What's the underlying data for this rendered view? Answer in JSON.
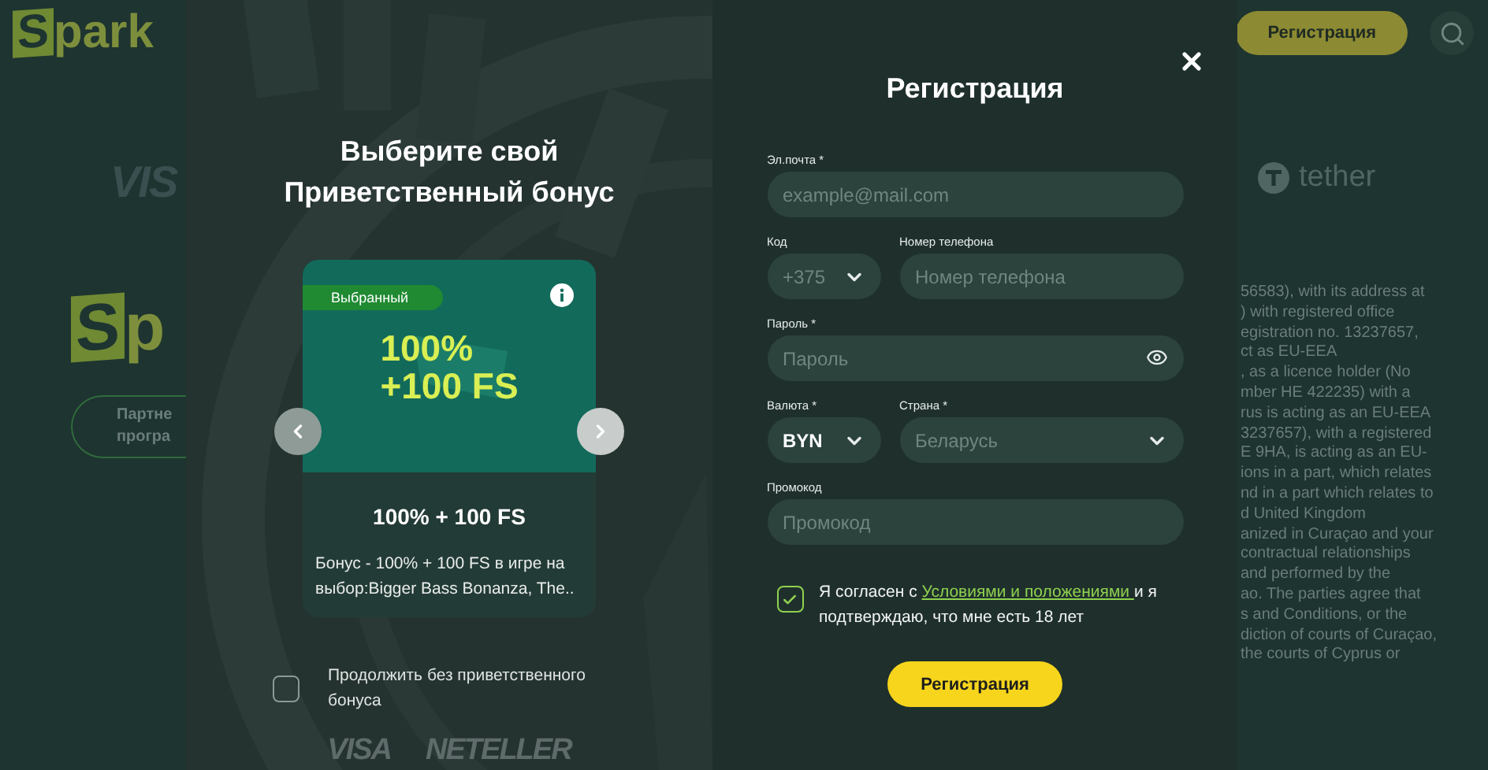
{
  "background_page": {
    "logo": {
      "mark": "S",
      "rest": "park"
    },
    "header_button": "Регистрация",
    "payment_logo": "VIS",
    "crypto_logo": "tether",
    "footer_logo": {
      "mark": "S",
      "rest": "p"
    },
    "partner_button": [
      "Партне",
      "програ"
    ],
    "legal_text_lines": [
      "56583), with its address at",
      ") with registered office",
      "egistration no. 13237657,",
      "ct as EU-EEA",
      ", as a licence holder (No",
      "mber HE 422235) with a",
      "rus is acting as an EU-EEA",
      "3237657), with a registered",
      "E 9HA, is acting as an EU-",
      "ions in a part, which relates",
      "nd in a part which relates to",
      "d United Kingdom",
      "anized in Curaçao and your",
      "contractual relationships",
      "and performed by the",
      "ao. The parties agree that",
      "s and Conditions, or the",
      "diction of courts of Curaçao,",
      "the courts of Cyprus or"
    ]
  },
  "bonus_panel": {
    "title_lines": [
      "Выберите свой",
      "Приветственный бонус"
    ],
    "offers": [
      {
        "badge": "Выбранный",
        "selected": true,
        "headline_lines": [
          "100%",
          "+100 FS"
        ],
        "name": "100% + 100 FS",
        "description": "Бонус - 100% + 100 FS в игре на выбор:Bigger Bass Bonanza, The.."
      }
    ],
    "skip_bonus": {
      "label": "Продолжить без приветственного бонуса",
      "checked": false
    },
    "payment_logos": [
      "VISA",
      "NETELLER"
    ]
  },
  "registration": {
    "title": "Регистрация",
    "rows": [
      [
        {
          "kind": "text",
          "label": "Эл.почта *",
          "placeholder": "example@mail.com"
        }
      ],
      [
        {
          "kind": "select",
          "label": "Код",
          "placeholder": "+375"
        },
        {
          "kind": "text",
          "label": "Номер телефона",
          "placeholder": "Номер телефона"
        }
      ],
      [
        {
          "kind": "password",
          "label": "Пароль *",
          "placeholder": "Пароль"
        }
      ],
      [
        {
          "kind": "select",
          "label": "Валюта *",
          "value": "BYN"
        },
        {
          "kind": "select",
          "label": "Страна *",
          "placeholder": "Беларусь"
        }
      ],
      [
        {
          "kind": "text",
          "label": "Промокод",
          "placeholder": "Промокод"
        }
      ]
    ],
    "terms": {
      "checked": true,
      "before": "Я согласен с ",
      "link": "Условиями и положениями ",
      "after": "и я подтверждаю, что мне есть 18 лет"
    },
    "submit": "Регистрация"
  }
}
